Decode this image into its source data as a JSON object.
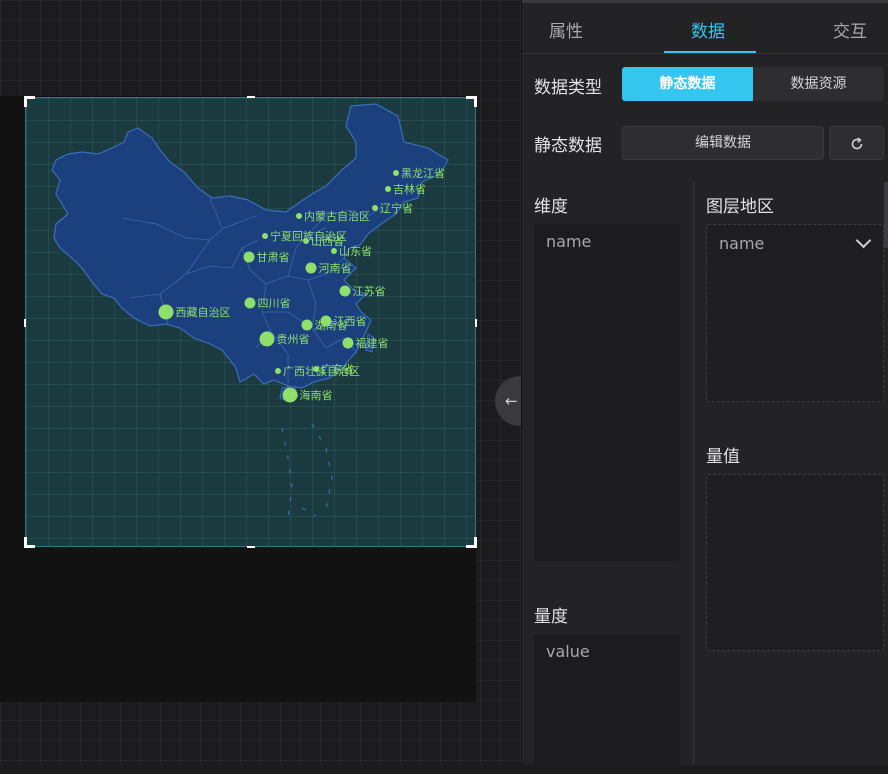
{
  "panel": {
    "tabs": [
      {
        "label": "属性",
        "active": false
      },
      {
        "label": "数据",
        "active": true
      },
      {
        "label": "交互",
        "active": false
      }
    ],
    "data_type": {
      "label": "数据类型",
      "options": [
        "静态数据",
        "数据资源"
      ],
      "selected": "静态数据"
    },
    "static_data": {
      "label": "静态数据",
      "edit_label": "编辑数据",
      "refresh_icon": "refresh-icon"
    },
    "dimension": {
      "title": "维度",
      "field": "name"
    },
    "measure": {
      "title": "量度",
      "field": "value"
    },
    "layer_region": {
      "title": "图层地区",
      "selected": "name"
    },
    "quantity": {
      "title": "量值"
    }
  },
  "collapse_icon": "arrow-left-icon",
  "colors": {
    "accent": "#35c6f0",
    "map_fill": "#1c3f7e",
    "map_border": "#3b6fb8",
    "point": "#8ee06b",
    "label": "#8ee06b"
  },
  "map": {
    "points": [
      {
        "name": "黑龙江省",
        "size": "small"
      },
      {
        "name": "吉林省",
        "size": "small"
      },
      {
        "name": "辽宁省",
        "size": "small"
      },
      {
        "name": "内蒙古自治区",
        "size": "small"
      },
      {
        "name": "宁夏回族自治区",
        "size": "small"
      },
      {
        "name": "山西省",
        "size": "small"
      },
      {
        "name": "山东省",
        "size": "small"
      },
      {
        "name": "甘肃省",
        "size": "medium"
      },
      {
        "name": "河南省",
        "size": "medium"
      },
      {
        "name": "江苏省",
        "size": "medium"
      },
      {
        "name": "四川省",
        "size": "medium"
      },
      {
        "name": "西藏自治区",
        "size": "large"
      },
      {
        "name": "湖南省",
        "size": "medium"
      },
      {
        "name": "江西省",
        "size": "medium"
      },
      {
        "name": "贵州省",
        "size": "large"
      },
      {
        "name": "福建省",
        "size": "medium"
      },
      {
        "name": "广西壮族自治区",
        "size": "small"
      },
      {
        "name": "广东省",
        "size": "small"
      },
      {
        "name": "海南省",
        "size": "large"
      }
    ]
  }
}
